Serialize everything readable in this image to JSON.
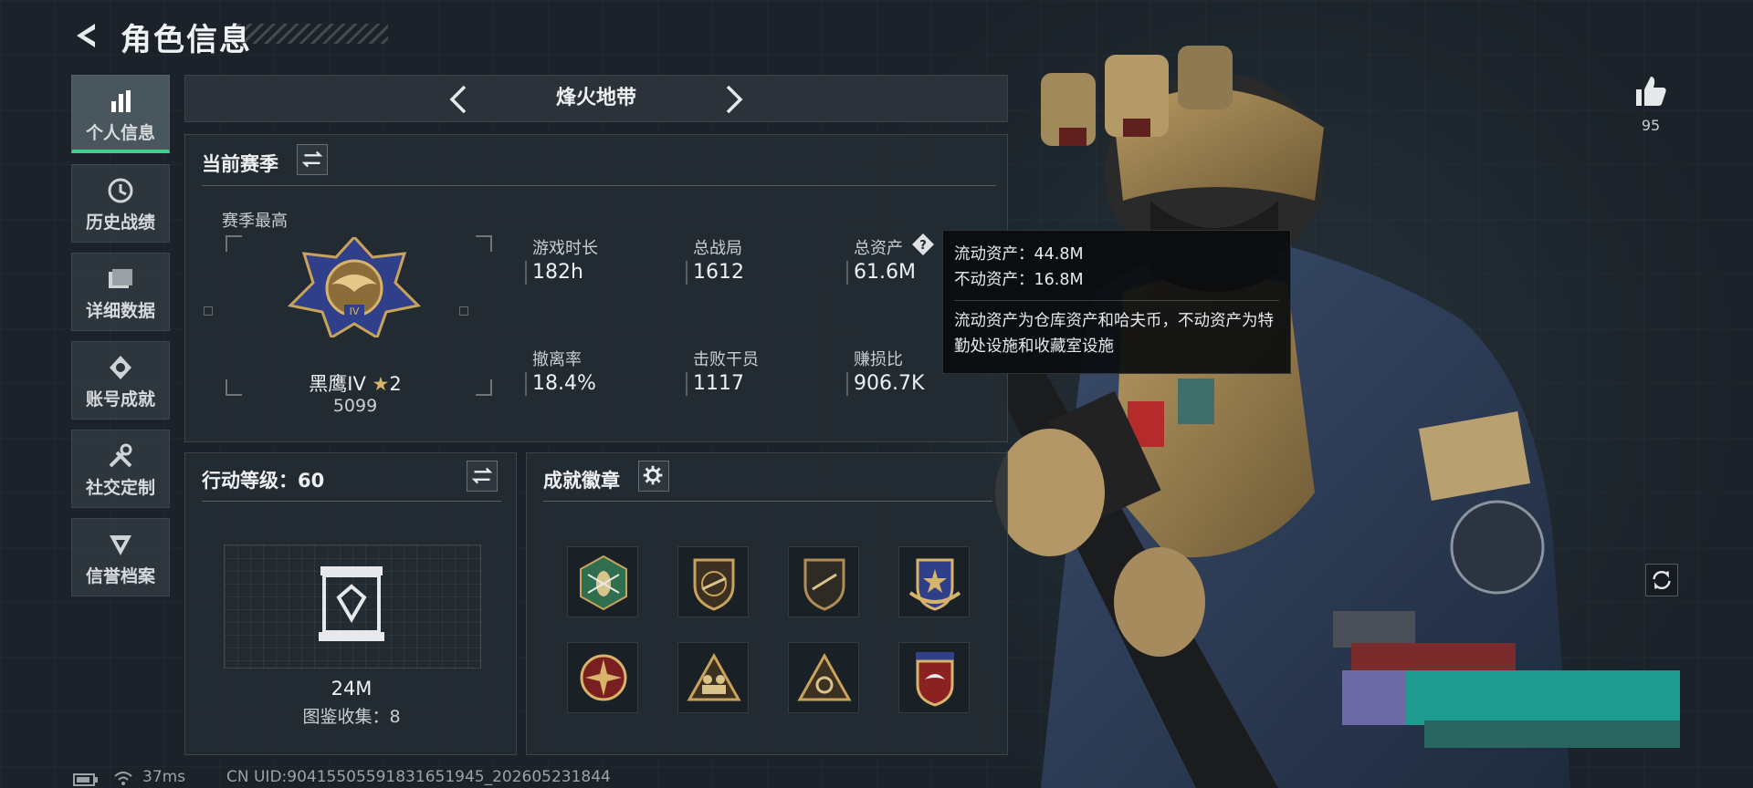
{
  "header": {
    "title": "角色信息"
  },
  "sidebar": {
    "items": [
      {
        "label": "个人信息",
        "icon": "bar-chart-icon",
        "active": true
      },
      {
        "label": "历史战绩",
        "icon": "history-clock-icon",
        "active": false
      },
      {
        "label": "详细数据",
        "icon": "folder-icon",
        "active": false
      },
      {
        "label": "账号成就",
        "icon": "achievement-icon",
        "active": false
      },
      {
        "label": "社交定制",
        "icon": "tools-icon",
        "active": false
      },
      {
        "label": "信誉档案",
        "icon": "reputation-icon",
        "active": false
      }
    ]
  },
  "mode": {
    "title": "烽火地带"
  },
  "season": {
    "title": "当前赛季",
    "best_label": "赛季最高",
    "rank_name": "黑鹰IV",
    "rank_stars": "2",
    "rank_score": "5099",
    "stats": [
      {
        "label": "游戏时长",
        "value": "182h"
      },
      {
        "label": "总战局",
        "value": "1612"
      },
      {
        "label": "总资产",
        "value": "61.6M"
      },
      {
        "label": "撤离率",
        "value": "18.4%"
      },
      {
        "label": "击败干员",
        "value": "1117"
      },
      {
        "label": "赚损比",
        "value": "906.7K"
      }
    ]
  },
  "tooltip": {
    "line1": "流动资产：44.8M",
    "line2": "不动资产：16.8M",
    "desc": "流动资产为仓库资产和哈夫币，不动资产为特勤处设施和收藏室设施"
  },
  "level": {
    "title": "行动等级：60",
    "value": "24M",
    "collection": "图鉴收集：8"
  },
  "badges": {
    "title": "成就徽章",
    "items": [
      "wasp-badge-icon",
      "rifle-shield-badge-icon",
      "rifle-shield-badge-icon",
      "star-wings-badge-icon",
      "star-compass-badge-icon",
      "soldiers-triangle-badge-icon",
      "triangle-emblem-badge-icon",
      "eagle-shield-badge-icon"
    ]
  },
  "likes": {
    "count": "95"
  },
  "footer": {
    "ping": "37ms",
    "uid": "CN UID:904155055918316519​45_202605231844"
  },
  "colors": {
    "accent": "#3fd18c",
    "background": "#1b2229",
    "gold": "#c9a35a"
  }
}
